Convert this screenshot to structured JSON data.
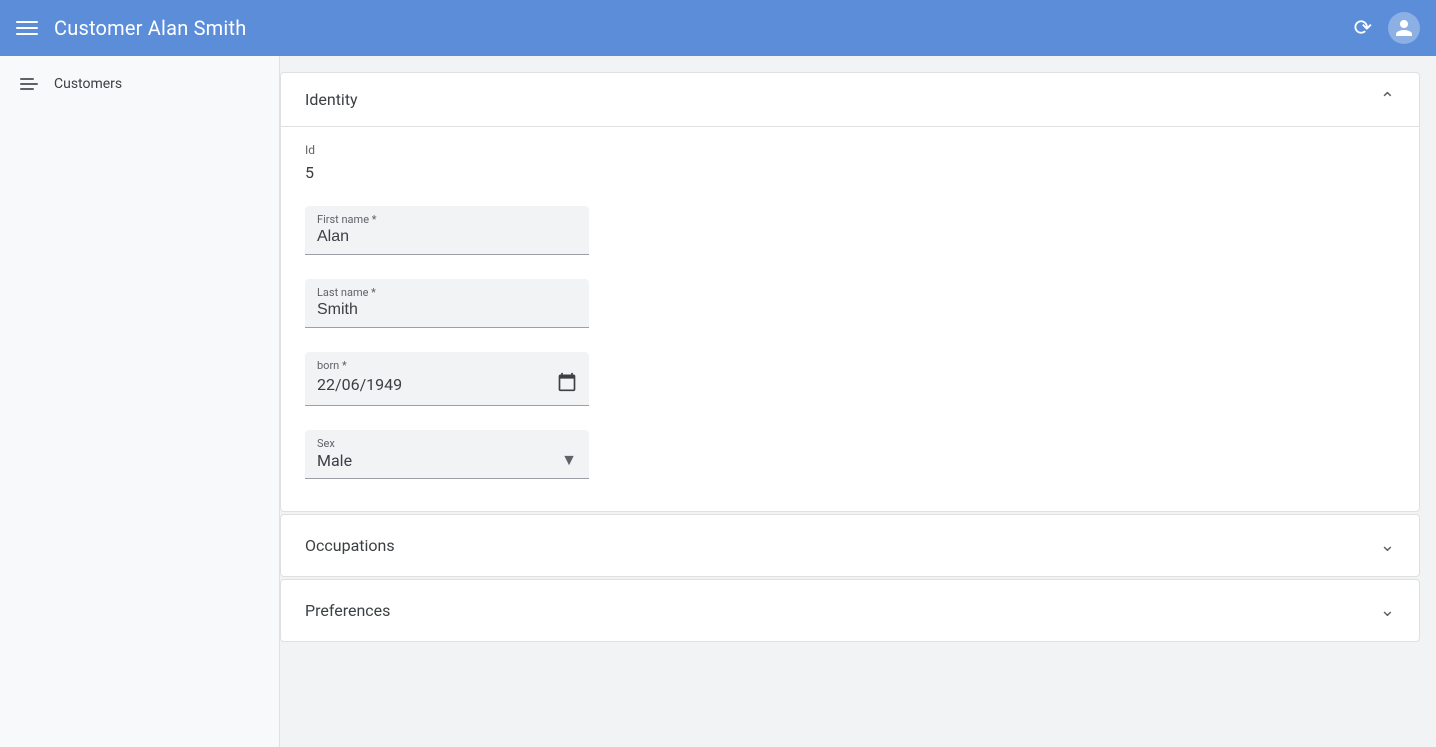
{
  "header": {
    "title": "Customer Alan Smith",
    "refresh_label": "↻",
    "account_label": "👤"
  },
  "sidebar": {
    "items": [
      {
        "label": "Customers"
      }
    ]
  },
  "identity_section": {
    "title": "Identity",
    "id_label": "Id",
    "id_value": "5",
    "first_name_label": "First name *",
    "first_name_value": "Alan",
    "last_name_label": "Last name *",
    "last_name_value": "Smith",
    "born_label": "born *",
    "born_value": "22/06/1949",
    "sex_label": "Sex",
    "sex_value": "Male"
  },
  "occupations_section": {
    "title": "Occupations"
  },
  "preferences_section": {
    "title": "Preferences"
  }
}
